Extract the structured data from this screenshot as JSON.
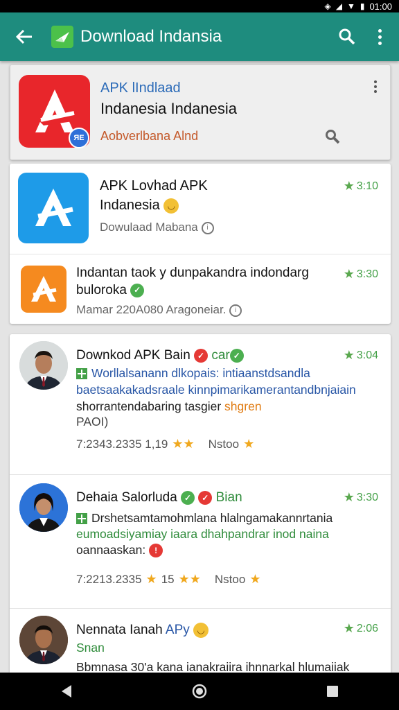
{
  "status_bar": {
    "time": "01:00"
  },
  "app_bar": {
    "title": "Download Indansia"
  },
  "featured": {
    "kicker": "APK lIndlaad",
    "name": "Indanesia Indanesia",
    "sub": "Aobverlbana Alnd",
    "badge": "ЯЕ",
    "colors": {
      "icon_bg": "#e8262b",
      "kicker": "#2c6bb8",
      "sub": "#c4592a"
    }
  },
  "apps": [
    {
      "title_line1": "APK Lovhad APK",
      "title_line2": "Indanesia",
      "sub": "Dowulaad Mabana",
      "rating": "3:10",
      "icon_color": "#1e9be8"
    },
    {
      "title_line1": "Indantan taok y dunpakandra indondarg",
      "title_line2": "buloroka",
      "sub": "Mamar 220A080 Aragoneiar.",
      "rating": "3:30",
      "icon_color": "#f58a1f"
    }
  ],
  "posts": [
    {
      "title": "Downkod APK Bain",
      "title_tag": "car",
      "rating": "3:04",
      "lines": [
        {
          "text": "Worllalsanann dlkopais: intiaanstdsandla",
          "style": "blue",
          "icon": "square"
        },
        {
          "text": "baetsaakakadsraale kinnpimarikamerantandbnjaiain",
          "style": "mixed"
        },
        {
          "text": "shorrantendabaring tasgier",
          "style": "dark",
          "tail": "shgren"
        },
        {
          "text": "PAOI)",
          "style": "dark"
        }
      ],
      "meta_left": "7:2343.2335 1,19",
      "meta_right": "Nstoo"
    },
    {
      "title": "Dehaia Salorluda",
      "title_tag": "Bian",
      "rating": "3:30",
      "lines": [
        {
          "text": "Drshetsamtamohmlana hlalngamakannrtania",
          "style": "dark",
          "icon": "square"
        },
        {
          "text": "eumoadsiyamiay iaara dhahpandrar inod naina",
          "style": "green"
        },
        {
          "text": "oannaaskan:",
          "style": "dark"
        }
      ],
      "meta_left": "7:2213.2335",
      "meta_mid": "15",
      "meta_right": "Nstoo"
    },
    {
      "title": "Nennata Ianah",
      "title_tag": "APy",
      "sub_tag": "Snan",
      "rating": "2:06",
      "lines": [
        {
          "text": "Bbmnasa 30'a kana ianakraiira ihnnarkal hlumaiiak",
          "style": "dark"
        }
      ]
    }
  ]
}
